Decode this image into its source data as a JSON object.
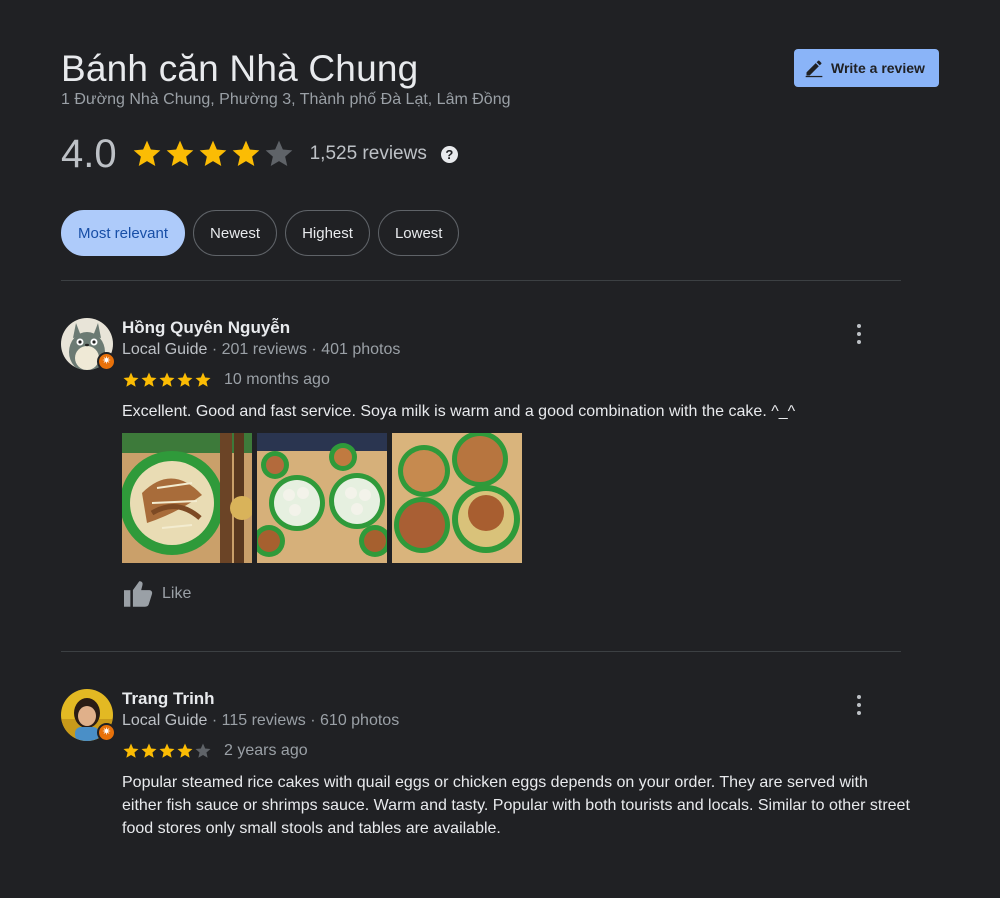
{
  "place": {
    "name": "Bánh căn Nhà Chung",
    "address": "1 Đường Nhà Chung, Phường 3, Thành phố Đà Lạt, Lâm Đồng",
    "rating": "4.0",
    "rating_value": 4.0,
    "review_count": "1,525 reviews"
  },
  "actions": {
    "write_review_label": "Write a review"
  },
  "filters": [
    "Most relevant",
    "Newest",
    "Highest",
    "Lowest"
  ],
  "active_filter": "Most relevant",
  "colors": {
    "background": "#202124",
    "accent": "#8ab4f8",
    "star": "#fbbc04",
    "star_empty": "#5f6368",
    "local_guide_badge": "#e8710a"
  },
  "reviews": [
    {
      "name": "Hồng Quyên Nguyễn",
      "guide_label": "Local Guide",
      "stats": " · 201 reviews · 401 photos",
      "stars": 5,
      "time": "10 months ago",
      "text": "Excellent.  Good and fast service. Soya milk is warm and a good combination with the cake.  ^_^",
      "photo_count": 3,
      "like_label": "Like"
    },
    {
      "name": "Trang Trinh",
      "guide_label": "Local Guide",
      "stats": " · 115 reviews · 610 photos",
      "stars": 4,
      "time": "2 years ago",
      "text": "Popular steamed rice cakes with quail eggs or chicken eggs depends on your order. They are served with either fish sauce or shrimps sauce. Warm and tasty. Popular with both tourists and locals. Similar to other street food stores only small stools and tables are available."
    }
  ],
  "icons": {
    "write": "pencil-icon",
    "help": "help-icon",
    "like": "thumbs-up-icon",
    "more": "more-vert-icon",
    "badge": "local-guide-badge-icon"
  }
}
